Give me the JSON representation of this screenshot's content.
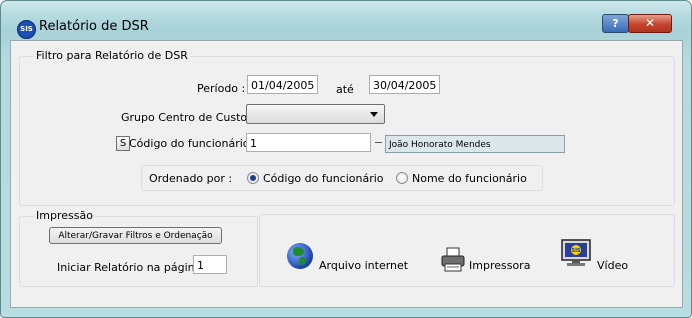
{
  "window": {
    "title": "Relatório de DSR",
    "app_icon_text": "SIS",
    "help_label": "?",
    "close_label": "✕"
  },
  "filter": {
    "group_title": "Filtro para Relatório de DSR",
    "periodo_label": "Período :",
    "periodo_start": "01/04/2005",
    "ate_label": "até",
    "periodo_end": "30/04/2005",
    "grupo_label": "Grupo Centro de Custo :",
    "grupo_value": "",
    "search_button_label": "S",
    "codigo_label": "Código do funcionário :",
    "codigo_value": "1",
    "employee_name": "João Honorato Mendes",
    "ordenado_label": "Ordenado por :",
    "order_options": [
      "Código do funcionário",
      "Nome  do funcionário"
    ],
    "order_selected": "Código do funcionário"
  },
  "impressao": {
    "group_title": "Impressão",
    "alterar_button": "Alterar/Gravar Filtros e Ordenação",
    "pagina_label": "Iniciar Relatório na página:",
    "pagina_value": "1"
  },
  "outputs": [
    {
      "label": "Arquivo internet",
      "icon": "globe-icon"
    },
    {
      "label": "Impressora",
      "icon": "printer-icon"
    },
    {
      "label": "Vídeo",
      "icon": "monitor-icon"
    }
  ]
}
